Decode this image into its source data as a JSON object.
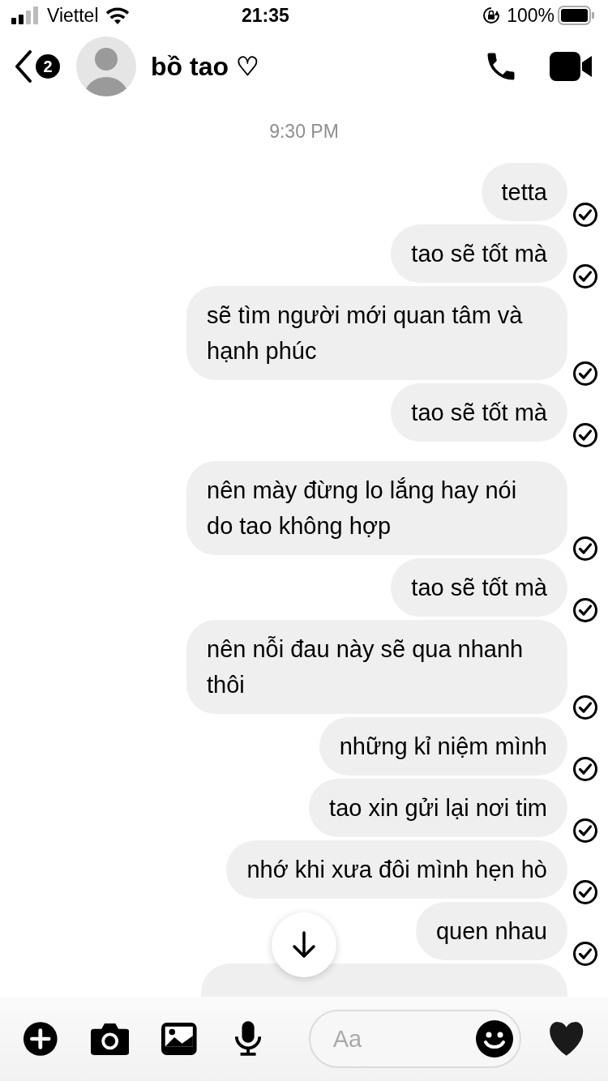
{
  "status_bar": {
    "carrier": "Viettel",
    "time": "21:35",
    "battery": "100%"
  },
  "header": {
    "back_badge": "2",
    "title": "bồ tao ♡"
  },
  "timestamp": "9:30 PM",
  "messages": [
    {
      "kind": "text",
      "text": "tetta",
      "delivered": true
    },
    {
      "kind": "text",
      "text": "tao sẽ tốt mà",
      "delivered": true
    },
    {
      "kind": "text",
      "text": "sẽ tìm người mới quan tâm và hạnh phúc",
      "delivered": true
    },
    {
      "kind": "text",
      "text": "tao sẽ tốt mà",
      "delivered": true
    },
    {
      "kind": "text",
      "text": "nên mày đừng lo lắng hay nói do tao không hợp",
      "delivered": true
    },
    {
      "kind": "text",
      "text": "tao sẽ tốt mà",
      "delivered": true
    },
    {
      "kind": "text",
      "text": "nên nỗi đau này sẽ qua nhanh thôi",
      "delivered": true
    },
    {
      "kind": "text",
      "text": "những kỉ niệm mình",
      "delivered": true
    },
    {
      "kind": "text",
      "text": "tao xin gửi lại nơi tim",
      "delivered": true
    },
    {
      "kind": "text",
      "text": "nhớ khi xưa đôi mình hẹn hò",
      "delivered": true
    },
    {
      "kind": "text",
      "text": "quen nhau",
      "delivered": true
    },
    {
      "kind": "cut_off"
    }
  ],
  "composer": {
    "placeholder": "Aa"
  }
}
